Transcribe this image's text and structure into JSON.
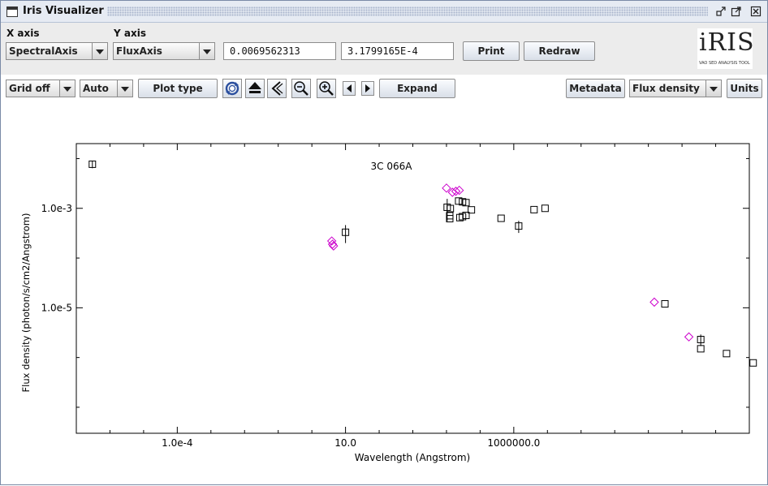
{
  "window": {
    "title": "Iris Visualizer",
    "icon": "window-icon",
    "controls": [
      "minimize-icon",
      "maximize-icon",
      "close-icon"
    ]
  },
  "toolbar": {
    "x_axis_label": "X axis",
    "y_axis_label": "Y axis",
    "x_axis_value": "SpectralAxis",
    "y_axis_value": "FluxAxis",
    "x_coord": "0.0069562313",
    "y_coord": "3.1799165E-4",
    "print_label": "Print",
    "redraw_label": "Redraw"
  },
  "logo": {
    "text": "iRIS",
    "subtitle": "VAO SED ANALYSIS TOOL"
  },
  "toolbar2": {
    "grid_value": "Grid off",
    "scale_value": "Auto",
    "plot_type_label": "Plot type",
    "tools": [
      "refresh-icon",
      "zoom-to-fit-icon",
      "zoom-back-icon",
      "zoom-out-icon",
      "zoom-in-icon"
    ],
    "pan": [
      "pan-left-icon",
      "pan-right-icon"
    ],
    "expand_label": "Expand",
    "metadata_label": "Metadata",
    "flux_value": "Flux density",
    "units_label": "Units"
  },
  "chart_data": {
    "type": "scatter",
    "title": "3C 066A",
    "xlabel": "Wavelength (Angstrom)",
    "ylabel": "Flux density (photon/s/cm2/Angstrom)",
    "xscale": "log",
    "yscale": "log",
    "xlim": [
      1e-07,
      10000000000000.0
    ],
    "ylim": [
      3e-08,
      0.02
    ],
    "xticks": [
      0.0001,
      10,
      1000000
    ],
    "xtick_labels": [
      "1.0e-4",
      "10.0",
      "1000000.0"
    ],
    "yticks": [
      1e-05,
      0.001
    ],
    "ytick_labels": [
      "1.0e-5",
      "1.0e-3"
    ],
    "grid": false,
    "series": [
      {
        "marker": "square",
        "color": "#000000",
        "points": [
          {
            "x": 3e-07,
            "y": 0.0077,
            "err": 0.0013
          },
          {
            "x": 10,
            "y": 0.00033,
            "err": 0.00013
          },
          {
            "x": 10500.0,
            "y": 0.00105,
            "err": 0.0005
          },
          {
            "x": 13000.0,
            "y": 0.00099
          },
          {
            "x": 12500.0,
            "y": 0.00071
          },
          {
            "x": 12500.0,
            "y": 0.00062
          },
          {
            "x": 23000.0,
            "y": 0.0014
          },
          {
            "x": 30000.0,
            "y": 0.00135
          },
          {
            "x": 38000.0,
            "y": 0.0013
          },
          {
            "x": 25000.0,
            "y": 0.00065
          },
          {
            "x": 30000.0,
            "y": 0.00068
          },
          {
            "x": 38000.0,
            "y": 0.00072
          },
          {
            "x": 55000.0,
            "y": 0.00093
          },
          {
            "x": 420000.0,
            "y": 0.00063
          },
          {
            "x": 1400000.0,
            "y": 0.00044,
            "err": 0.00012
          },
          {
            "x": 4000000.0,
            "y": 0.00094
          },
          {
            "x": 8500000.0,
            "y": 0.001
          },
          {
            "x": 31000000000.0,
            "y": 1.2e-05
          },
          {
            "x": 360000000000.0,
            "y": 2.3e-06,
            "err": 6e-07
          },
          {
            "x": 360000000000.0,
            "y": 1.5e-06
          },
          {
            "x": 2100000000000.0,
            "y": 1.2e-06
          },
          {
            "x": 13000000000000.0,
            "y": 7.8e-07
          },
          {
            "x": 55000000000000.0,
            "y": 4.3e-07
          }
        ]
      },
      {
        "marker": "diamond",
        "color": "#cc00cc",
        "points": [
          {
            "x": 3.9,
            "y": 0.00022
          },
          {
            "x": 4.1,
            "y": 0.00019
          },
          {
            "x": 4.4,
            "y": 0.000175
          },
          {
            "x": 10000.0,
            "y": 0.00255
          },
          {
            "x": 15000.0,
            "y": 0.0021
          },
          {
            "x": 19000.0,
            "y": 0.0022
          },
          {
            "x": 24000.0,
            "y": 0.0023
          },
          {
            "x": 15000000000.0,
            "y": 1.3e-05
          },
          {
            "x": 160000000000.0,
            "y": 2.6e-06
          }
        ]
      }
    ]
  }
}
